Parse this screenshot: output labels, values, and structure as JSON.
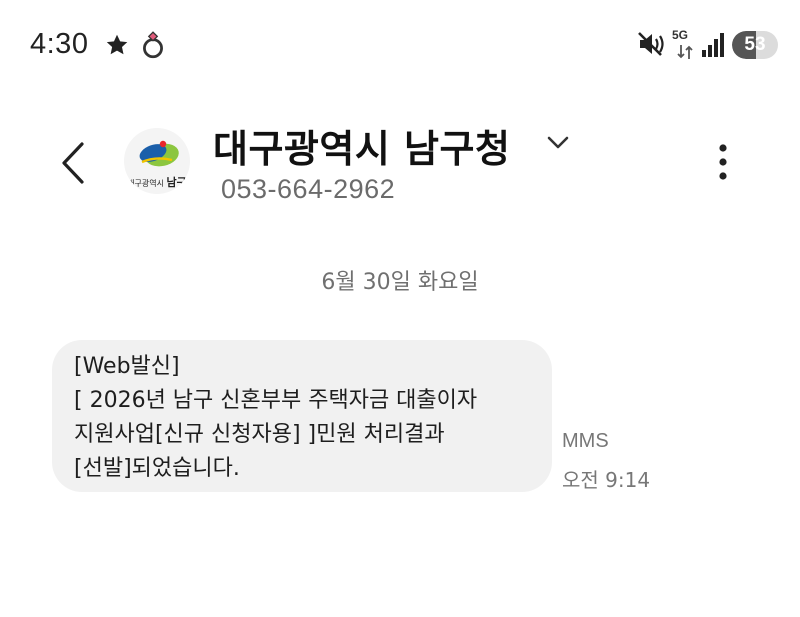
{
  "status_bar": {
    "time": "4:30",
    "network": "5G",
    "battery": "53",
    "battery_percent": 53
  },
  "header": {
    "contact_name": "대구광역시 남구청",
    "phone_number": "053-664-2962",
    "avatar_logo_small": "대구광역시",
    "avatar_logo_big": "남구",
    "icons": {
      "back": "chevron-left-icon",
      "expand": "chevron-down-icon",
      "menu": "more-vertical-icon"
    }
  },
  "conversation": {
    "date": "6월 30일 화요일",
    "messages": [
      {
        "lines": [
          "[Web발신]",
          "[ 2026년 남구 신혼부부 주택자금 대출이자",
          "지원사업[신규 신청자용] ]민원 처리결과",
          "[선발]되었습니다."
        ],
        "type": "MMS",
        "time": "오전 9:14"
      }
    ]
  }
}
